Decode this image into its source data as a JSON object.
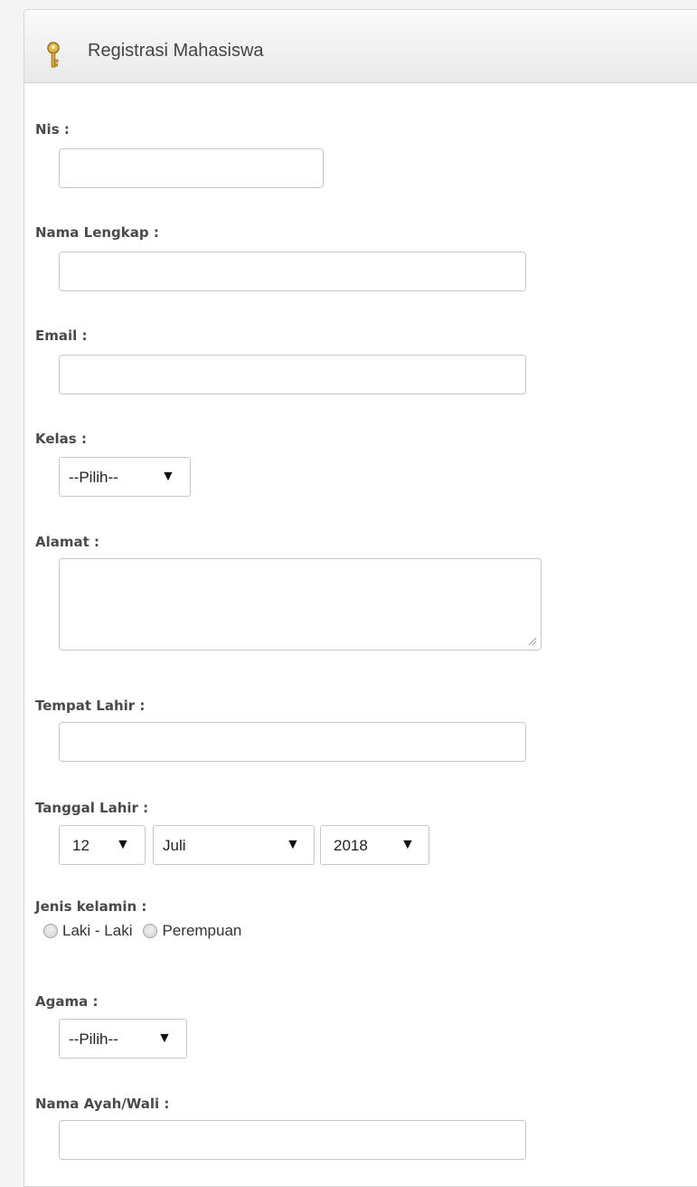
{
  "header": {
    "title": "Registrasi Mahasiswa",
    "icon": "key-icon"
  },
  "form": {
    "nis": {
      "label": "Nis :",
      "value": ""
    },
    "nama_lengkap": {
      "label": "Nama Lengkap :",
      "value": ""
    },
    "email": {
      "label": "Email :",
      "value": ""
    },
    "kelas": {
      "label": "Kelas :",
      "selected": "--Pilih--"
    },
    "alamat": {
      "label": "Alamat :",
      "value": ""
    },
    "tempat_lahir": {
      "label": "Tempat Lahir :",
      "value": ""
    },
    "tanggal_lahir": {
      "label": "Tanggal Lahir :",
      "day": "12",
      "month": "Juli",
      "year": "2018"
    },
    "jenis_kelamin": {
      "label": "Jenis kelamin :",
      "options": [
        "Laki - Laki",
        "Perempuan"
      ]
    },
    "agama": {
      "label": "Agama :",
      "selected": "--Pilih--"
    },
    "nama_ayah": {
      "label": "Nama Ayah/Wali :",
      "value": ""
    }
  },
  "colors": {
    "label": "#4a4a4a",
    "border": "#c8c8c8",
    "header_bg": "#eeeeee"
  }
}
